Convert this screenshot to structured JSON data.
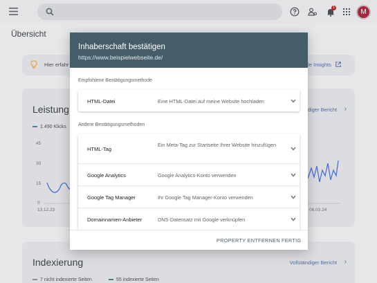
{
  "header": {
    "avatar_letter": "M",
    "notification_count": "1"
  },
  "page": {
    "title": "Übersicht"
  },
  "insight": {
    "text": "Hier erfahr",
    "link": "le Insights"
  },
  "performance": {
    "title": "Leistung",
    "clicks_label": "1.490 Klicks",
    "link": "diger Bericht",
    "chevron": "›",
    "y_ticks": [
      "45",
      "30",
      "15",
      "0"
    ],
    "x_labels": [
      "13.12.23",
      "06.03.24"
    ]
  },
  "indexing": {
    "title": "Indexierung",
    "link": "Vollständiger Bericht",
    "chevron": "›",
    "not_indexed": "7 nicht indexierte Seiten",
    "indexed": "55 indexierte Seiten"
  },
  "dialog": {
    "title": "Inhaberschaft bestätigen",
    "url": "https://www.beispielwebseite.de/",
    "recommended_label": "Empfohlene Bestätigungsmethode",
    "recommended": {
      "name": "HTML-Datei",
      "description": "Eine HTML-Datei auf meine Website hochladen"
    },
    "other_label": "Andere Bestätigungsmethoden",
    "others": [
      {
        "name": "HTML-Tag",
        "description": "Ein Meta-Tag zur Startseite Ihrer Website hinzufügen"
      },
      {
        "name": "Google Analytics",
        "description": "Google Analytics-Konto verwenden"
      },
      {
        "name": "Google Tag Manager",
        "description": "Ihr Google Tag Manager-Konto verwenden"
      },
      {
        "name": "Domainnamen-Anbieter",
        "description": "DNS-Datensatz mit Google verknüpfen"
      }
    ],
    "remove_button": "PROPERTY ENTFERNEN",
    "done_button": "FERTIG"
  },
  "colors": {
    "dialog_header": "#455d69",
    "accent_link": "#5069a6",
    "chart_line": "#4a6fd1"
  }
}
